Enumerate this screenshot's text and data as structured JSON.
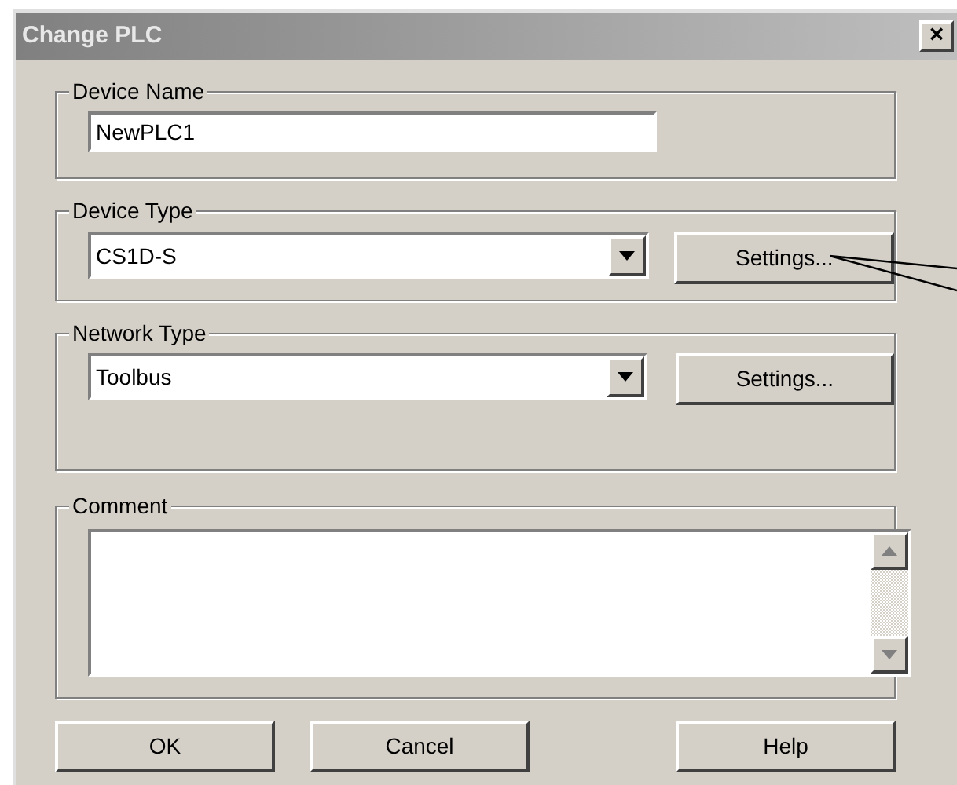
{
  "window": {
    "title": "Change PLC",
    "close": "×"
  },
  "device_name": {
    "label": "Device Name",
    "value": "NewPLC1"
  },
  "device_type": {
    "label": "Device Type",
    "value": "CS1D-S",
    "button": "Settings..."
  },
  "network_type": {
    "label": "Network Type",
    "value": "Toolbus",
    "button": "Settings..."
  },
  "comment": {
    "label": "Comment"
  },
  "buttons": [
    {
      "label": "OK"
    },
    {
      "label": "Cancel"
    },
    {
      "label": "Help"
    }
  ]
}
